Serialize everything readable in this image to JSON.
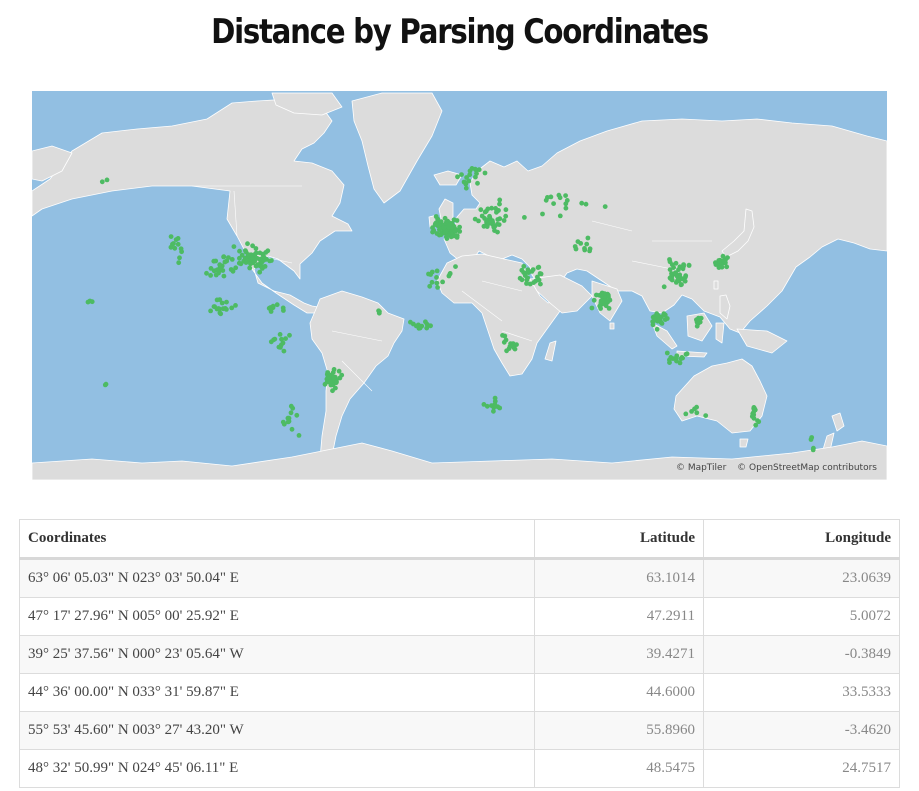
{
  "page": {
    "title": "Distance by Parsing Coordinates"
  },
  "map": {
    "colors": {
      "ocean": "#92bfe2",
      "land": "#dcdcdc",
      "border": "#ffffff",
      "point": "#4dbb63"
    },
    "attribution": {
      "maptiler": "© MapTiler",
      "osm": "© OpenStreetMap contributors"
    },
    "clusters": [
      {
        "region": "north-america-east",
        "lon": -82,
        "lat": 38,
        "spread_lon": 12,
        "spread_lat": 6,
        "count": 60
      },
      {
        "region": "north-america-central",
        "lon": -97,
        "lat": 35,
        "spread_lon": 9,
        "spread_lat": 7,
        "count": 25
      },
      {
        "region": "north-america-west",
        "lon": -117,
        "lat": 40,
        "spread_lon": 6,
        "spread_lat": 8,
        "count": 12
      },
      {
        "region": "mexico-central-america",
        "lon": -97,
        "lat": 18,
        "spread_lon": 8,
        "spread_lat": 5,
        "count": 18
      },
      {
        "region": "caribbean",
        "lon": -72,
        "lat": 18,
        "spread_lon": 8,
        "spread_lat": 3,
        "count": 8
      },
      {
        "region": "south-america-north",
        "lon": -70,
        "lat": 2,
        "spread_lon": 8,
        "spread_lat": 6,
        "count": 12
      },
      {
        "region": "brazil-east",
        "lon": -45,
        "lat": -15,
        "spread_lon": 6,
        "spread_lat": 8,
        "count": 35
      },
      {
        "region": "south-america-south",
        "lon": -65,
        "lat": -33,
        "spread_lon": 5,
        "spread_lat": 8,
        "count": 12
      },
      {
        "region": "europe-west",
        "lon": 6,
        "lat": 48,
        "spread_lon": 8,
        "spread_lat": 5,
        "count": 90
      },
      {
        "region": "europe-east",
        "lon": 28,
        "lat": 50,
        "spread_lon": 10,
        "spread_lat": 7,
        "count": 40
      },
      {
        "region": "scandinavia",
        "lon": 18,
        "lat": 61,
        "spread_lon": 8,
        "spread_lat": 4,
        "count": 18
      },
      {
        "region": "russia",
        "lon": 60,
        "lat": 55,
        "spread_lon": 25,
        "spread_lat": 5,
        "count": 16
      },
      {
        "region": "middle-east",
        "lon": 45,
        "lat": 31,
        "spread_lon": 9,
        "spread_lat": 6,
        "count": 25
      },
      {
        "region": "north-africa",
        "lon": 5,
        "lat": 30,
        "spread_lon": 15,
        "spread_lat": 6,
        "count": 14
      },
      {
        "region": "west-africa",
        "lon": -5,
        "lat": 10,
        "spread_lon": 8,
        "spread_lat": 4,
        "count": 12
      },
      {
        "region": "east-africa",
        "lon": 35,
        "lat": 2,
        "spread_lon": 6,
        "spread_lat": 8,
        "count": 14
      },
      {
        "region": "southern-africa",
        "lon": 28,
        "lat": -25,
        "spread_lon": 6,
        "spread_lat": 5,
        "count": 12
      },
      {
        "region": "india",
        "lon": 78,
        "lat": 21,
        "spread_lon": 6,
        "spread_lat": 7,
        "count": 30
      },
      {
        "region": "central-asia",
        "lon": 68,
        "lat": 42,
        "spread_lon": 10,
        "spread_lat": 4,
        "count": 10
      },
      {
        "region": "china",
        "lon": 112,
        "lat": 32,
        "spread_lon": 9,
        "spread_lat": 8,
        "count": 40
      },
      {
        "region": "korea-japan",
        "lon": 132,
        "lat": 36,
        "spread_lon": 5,
        "spread_lat": 3,
        "count": 20
      },
      {
        "region": "southeast-asia",
        "lon": 104,
        "lat": 12,
        "spread_lon": 5,
        "spread_lat": 6,
        "count": 22
      },
      {
        "region": "indonesia",
        "lon": 112,
        "lat": -5,
        "spread_lon": 10,
        "spread_lat": 3,
        "count": 14
      },
      {
        "region": "philippines",
        "lon": 122,
        "lat": 12,
        "spread_lon": 2,
        "spread_lat": 4,
        "count": 10
      },
      {
        "region": "australia-east",
        "lon": 148,
        "lat": -30,
        "spread_lon": 3,
        "spread_lat": 6,
        "count": 12
      },
      {
        "region": "australia-west",
        "lon": 120,
        "lat": -28,
        "spread_lon": 8,
        "spread_lat": 6,
        "count": 6
      },
      {
        "region": "new-zealand",
        "lon": 174,
        "lat": -40,
        "spread_lon": 2,
        "spread_lat": 3,
        "count": 4
      },
      {
        "region": "hawaii",
        "lon": -157,
        "lat": 20,
        "spread_lon": 2,
        "spread_lat": 1,
        "count": 3
      },
      {
        "region": "pacific-islands",
        "lon": -149,
        "lat": -17,
        "spread_lon": 2,
        "spread_lat": 1,
        "count": 2
      },
      {
        "region": "alaska",
        "lon": -150,
        "lat": 61,
        "spread_lon": 3,
        "spread_lat": 2,
        "count": 2
      },
      {
        "region": "atlantic-islands",
        "lon": -25,
        "lat": 15,
        "spread_lon": 3,
        "spread_lat": 3,
        "count": 3
      }
    ]
  },
  "table": {
    "headers": {
      "coordinates": "Coordinates",
      "latitude": "Latitude",
      "longitude": "Longitude"
    },
    "rows": [
      {
        "coordinates": "63° 06' 05.03\" N 023° 03' 50.04\" E",
        "latitude": "63.1014",
        "longitude": "23.0639"
      },
      {
        "coordinates": "47° 17' 27.96\" N 005° 00' 25.92\" E",
        "latitude": "47.2911",
        "longitude": "5.0072"
      },
      {
        "coordinates": "39° 25' 37.56\" N 000° 23' 05.64\" W",
        "latitude": "39.4271",
        "longitude": "-0.3849"
      },
      {
        "coordinates": "44° 36' 00.00\" N 033° 31' 59.87\" E",
        "latitude": "44.6000",
        "longitude": "33.5333"
      },
      {
        "coordinates": "55° 53' 45.60\" N 003° 27' 43.20\" W",
        "latitude": "55.8960",
        "longitude": "-3.4620"
      },
      {
        "coordinates": "48° 32' 50.99\" N 024° 45' 06.11\" E",
        "latitude": "48.5475",
        "longitude": "24.7517"
      }
    ]
  }
}
